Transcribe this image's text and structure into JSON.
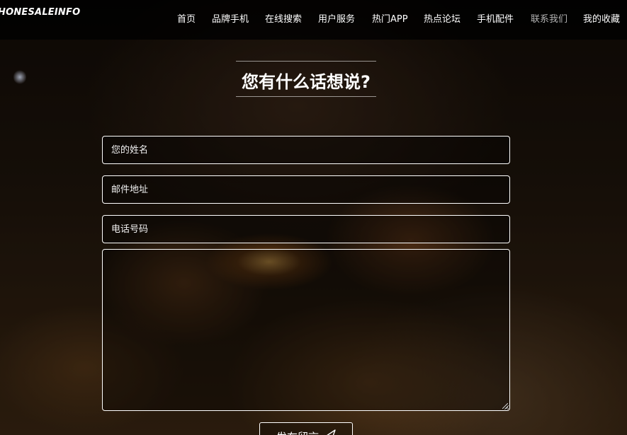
{
  "navbar": {
    "brand": "HONESALEINFO",
    "items": [
      {
        "label": "首页"
      },
      {
        "label": "品牌手机"
      },
      {
        "label": "在线搜索"
      },
      {
        "label": "用户服务"
      },
      {
        "label": "热门APP"
      },
      {
        "label": "热点论坛"
      },
      {
        "label": "手机配件"
      },
      {
        "label": "联系我们",
        "active": true
      },
      {
        "label": "我的收藏"
      }
    ]
  },
  "contact": {
    "heading": "您有什么话想说?",
    "name_placeholder": "您的姓名",
    "email_placeholder": "邮件地址",
    "phone_placeholder": "电话号码",
    "message_placeholder": "",
    "submit_label": "发布留言",
    "submit_icon": "paper-plane-icon"
  },
  "colors": {
    "navbar_bg": "#000000",
    "text": "#ffffff",
    "active_nav": "#b3b3b3",
    "border": "#ffffff"
  }
}
